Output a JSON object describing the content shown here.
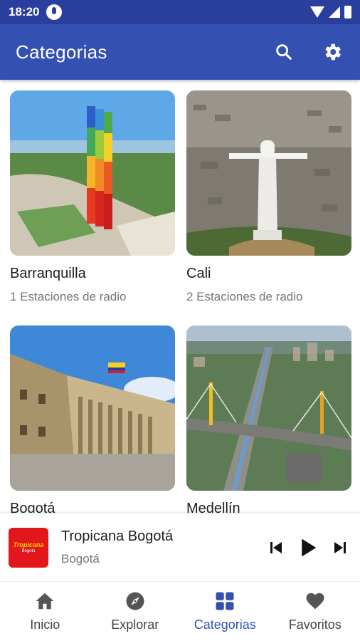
{
  "status_bar": {
    "time": "18:20"
  },
  "app_bar": {
    "title": "Categorias",
    "accent": "#3451b2"
  },
  "categories": [
    {
      "name": "Barranquilla",
      "stations": "1 Estaciones de radio",
      "image": "barranquilla-tower"
    },
    {
      "name": "Cali",
      "stations": "2 Estaciones de radio",
      "image": "cali-cristo-rey"
    },
    {
      "name": "Bogotá",
      "stations": "",
      "image": "bogota-capitolio"
    },
    {
      "name": "Medellín",
      "stations": "",
      "image": "medellin-bridge"
    }
  ],
  "player": {
    "station_name": "Tropicana Bogotá",
    "station_city": "Bogotá",
    "logo_text": "Tropicana",
    "logo_sub": "Bogotá"
  },
  "bottom_nav": [
    {
      "label": "Inicio",
      "icon": "home-icon"
    },
    {
      "label": "Explorar",
      "icon": "compass-icon"
    },
    {
      "label": "Categorias",
      "icon": "grid-icon",
      "active": true
    },
    {
      "label": "Favoritos",
      "icon": "heart-icon"
    }
  ]
}
